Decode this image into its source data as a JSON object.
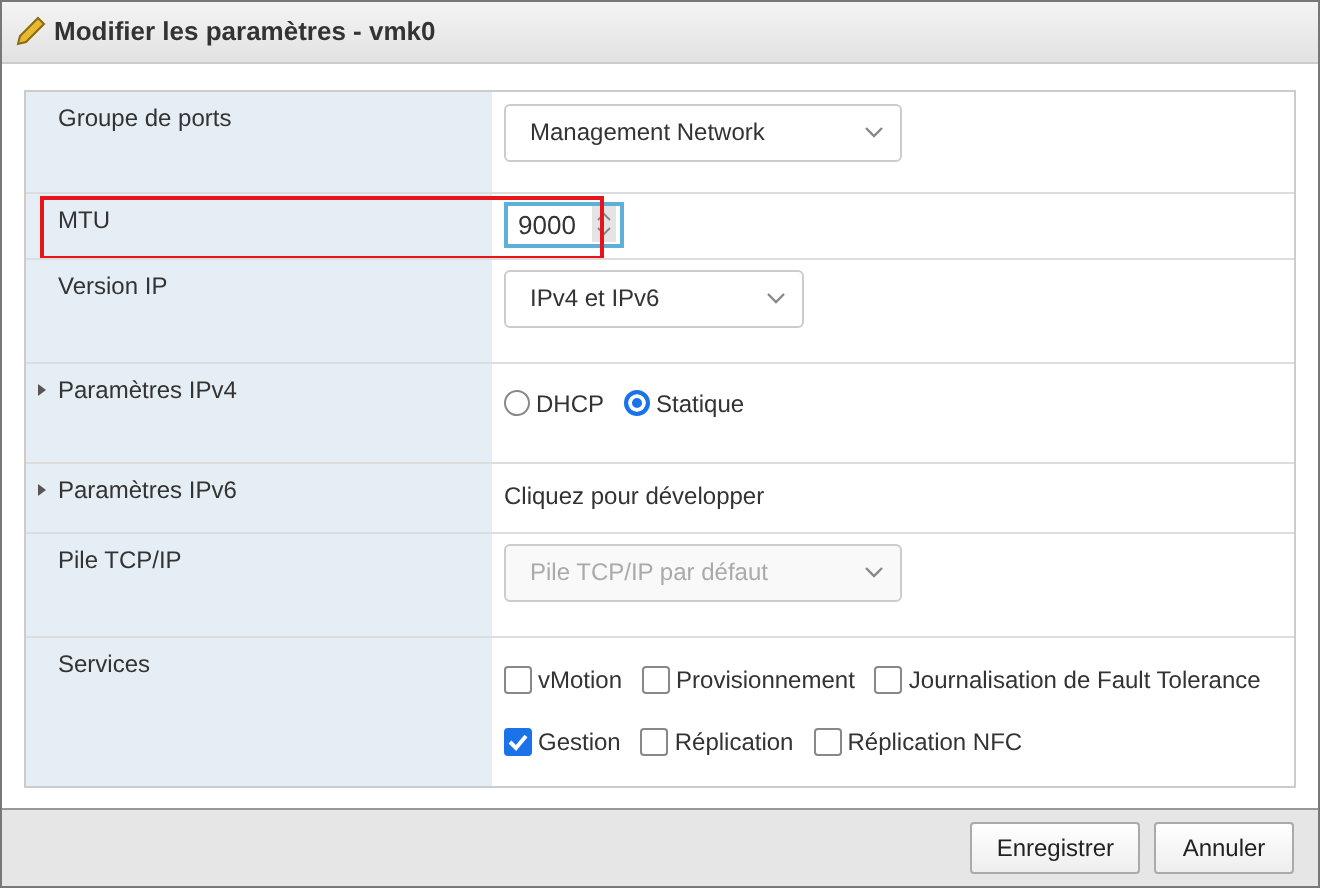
{
  "window": {
    "title": "Modifier les paramètres - vmk0"
  },
  "rows": [
    {
      "kind": "select",
      "label": "Groupe de ports",
      "expandable": false,
      "highlighted": false,
      "value": "Management Network",
      "disabled": false,
      "compact": false
    },
    {
      "kind": "number",
      "label": "MTU",
      "expandable": false,
      "highlighted": true,
      "value": "9000"
    },
    {
      "kind": "select",
      "label": "Version IP",
      "expandable": false,
      "highlighted": false,
      "value": "IPv4 et IPv6",
      "disabled": false,
      "compact": true
    },
    {
      "kind": "radio",
      "label": "Paramètres IPv4",
      "expandable": true,
      "highlighted": false,
      "options": [
        {
          "label": "DHCP",
          "selected": false
        },
        {
          "label": "Statique",
          "selected": true
        }
      ]
    },
    {
      "kind": "text",
      "label": "Paramètres IPv6",
      "expandable": true,
      "highlighted": false,
      "value": "Cliquez pour développer"
    },
    {
      "kind": "select",
      "label": "Pile TCP/IP",
      "expandable": false,
      "highlighted": false,
      "value": "Pile TCP/IP par défaut",
      "disabled": true,
      "compact": false
    },
    {
      "kind": "checks",
      "label": "Services",
      "expandable": false,
      "highlighted": false,
      "lines": [
        [
          {
            "label": "vMotion",
            "checked": false
          },
          {
            "label": "Provisionnement",
            "checked": false
          },
          {
            "label": "Journalisation de Fault Tolerance",
            "checked": false
          }
        ],
        [
          {
            "label": "Gestion",
            "checked": true
          },
          {
            "label": "Réplication",
            "checked": false
          },
          {
            "label": "Réplication NFC",
            "checked": false
          }
        ]
      ]
    }
  ],
  "buttons": [
    "Enregistrer",
    "Annuler"
  ]
}
